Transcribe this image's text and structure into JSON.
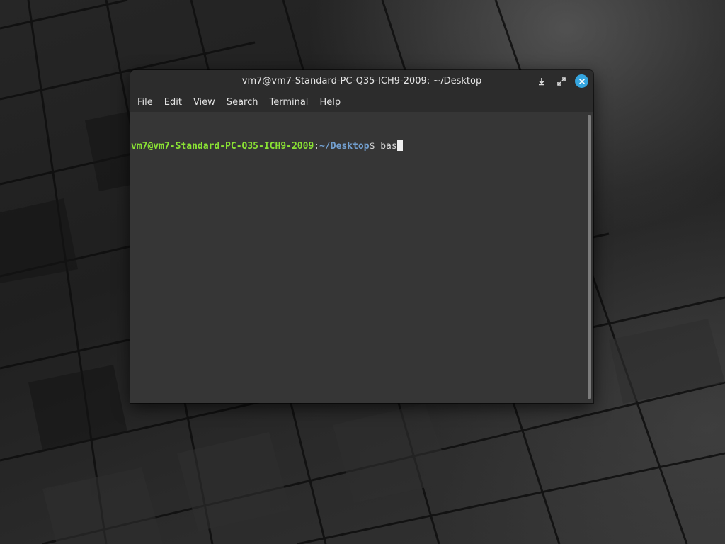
{
  "window": {
    "title": "vm7@vm7-Standard-PC-Q35-ICH9-2009: ~/Desktop",
    "controls": {
      "minimize_icon": "download-arrow-icon",
      "maximize_icon": "expand-arrows-icon",
      "close_icon": "close-icon",
      "close_color": "#35a6e0"
    }
  },
  "menu": {
    "items": [
      "File",
      "Edit",
      "View",
      "Search",
      "Terminal",
      "Help"
    ]
  },
  "terminal": {
    "prompt_user": "vm7@vm7-Standard-PC-Q35-ICH9-2009",
    "prompt_colon": ":",
    "prompt_path": "~/Desktop",
    "prompt_symbol": "$ ",
    "command": "bas",
    "colors": {
      "user": "#8ae234",
      "path": "#729fcf",
      "background": "#363636"
    }
  }
}
